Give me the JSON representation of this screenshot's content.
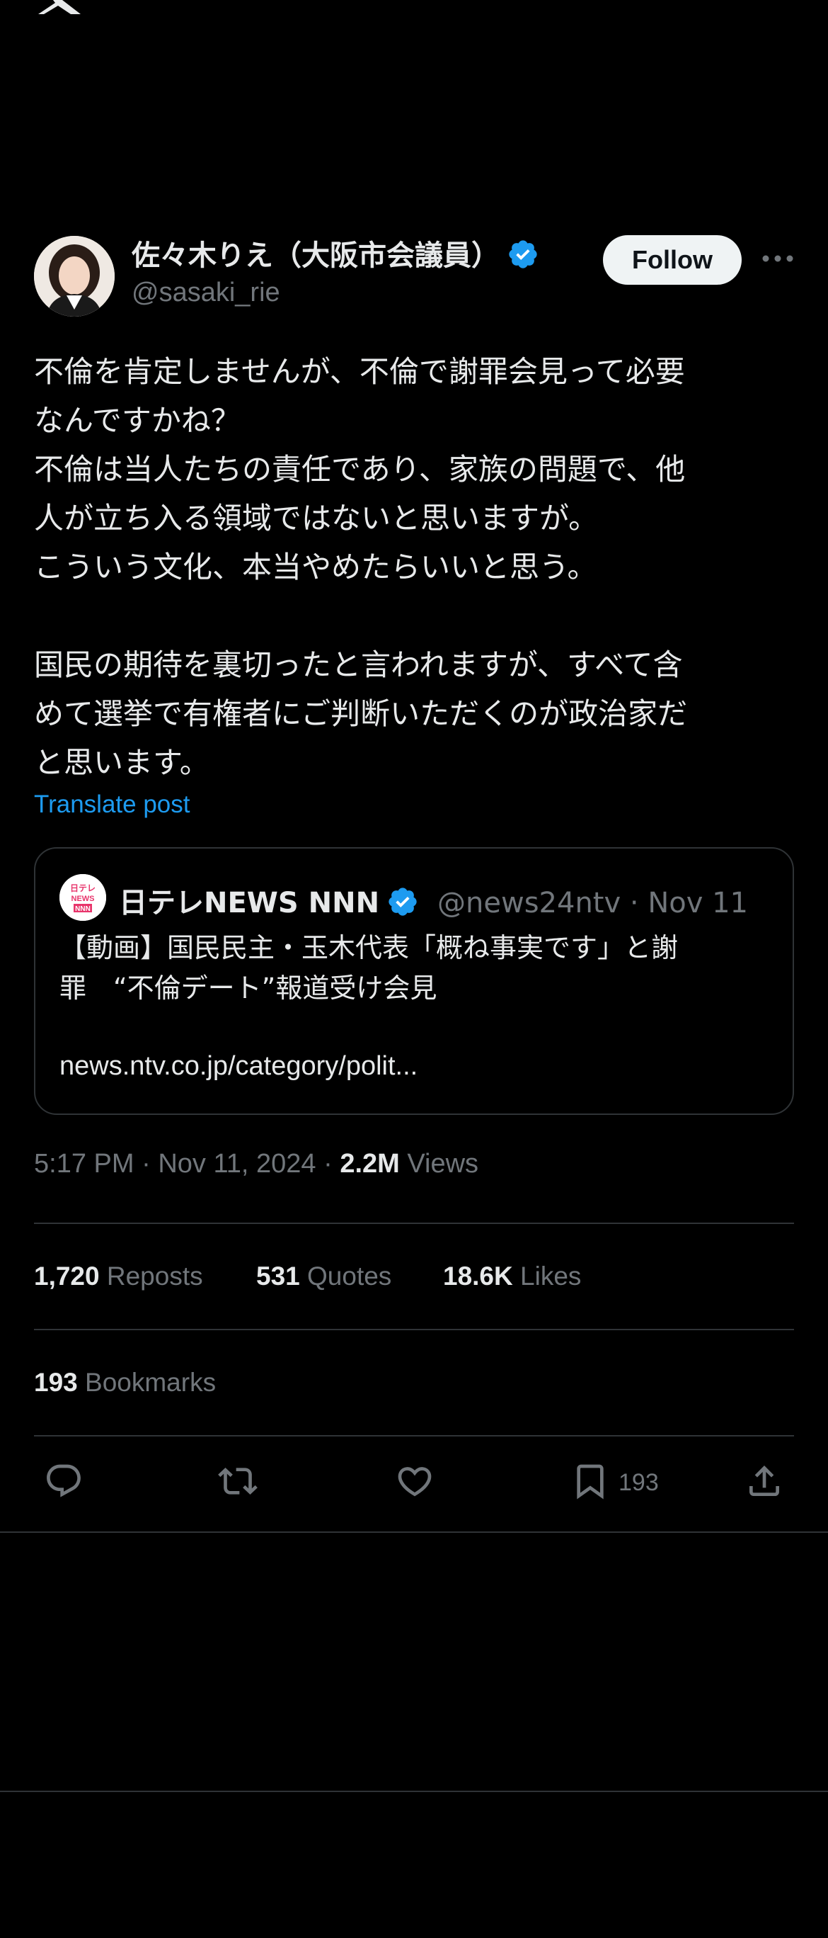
{
  "post": {
    "author_name": "佐々木りえ（大阪市会議員）",
    "author_handle": "@sasaki_rie",
    "follow_label": "Follow",
    "text": "不倫を肯定しませんが、不倫で謝罪会見って必要\nなんですかね？\n不倫は当人たちの責任であり、家族の問題で、他\n人が立ち入る領域ではないと思いますが。\nこういう文化、本当やめたらいいと思う。\n\n国民の期待を裏切ったと言われますが、すべて含\nめて選挙で有権者にご判断いただくのが政治家だ\nと思います。",
    "translate_label": "Translate post",
    "time": "5:17 PM",
    "date": "Nov 11, 2024",
    "views_count": "2.2M",
    "views_label": "Views"
  },
  "quote": {
    "name": "日テレNEWS NNN",
    "handle": "@news24ntv",
    "date": "Nov 11",
    "text": "【動画】国民民主・玉木代表「概ね事実です」と謝\n罪　“不倫デート”報道受け会見",
    "link": "news.ntv.co.jp/category/polit..."
  },
  "stats": {
    "reposts_count": "1,720",
    "reposts_label": "Reposts",
    "quotes_count": "531",
    "quotes_label": "Quotes",
    "likes_count": "18.6K",
    "likes_label": "Likes",
    "bookmarks_count": "193",
    "bookmarks_label": "Bookmarks"
  },
  "actions": {
    "bookmark_count": "193"
  },
  "icons": [
    "x-logo-icon",
    "verified-badge-icon",
    "more-icon",
    "reply-icon",
    "repost-icon",
    "like-icon",
    "bookmark-icon",
    "share-icon"
  ],
  "colors": {
    "background": "#000000",
    "accent": "#1d9bf0",
    "muted": "#71767b",
    "text": "#e7e9ea",
    "border": "#2f3336"
  }
}
